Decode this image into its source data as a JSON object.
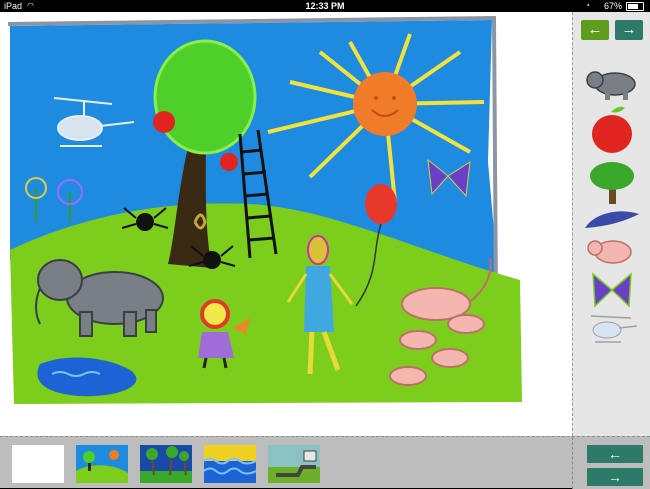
{
  "status_bar": {
    "carrier": "iPad",
    "time": "12:33 PM",
    "battery": "67%"
  },
  "sidebar": {
    "back_arrow": "←",
    "forward_arrow": "→",
    "stamps": [
      "elephant",
      "apple",
      "tree",
      "blue-cloud",
      "pig",
      "butterfly",
      "helicopter"
    ]
  },
  "bottom_bar": {
    "scenes": [
      "blank-scene",
      "park-scene",
      "palm-beach-scene",
      "ocean-waves-scene",
      "road-scene"
    ],
    "nav_back": "←",
    "nav_forward": "→"
  },
  "colors": {
    "sky": "#1f8be0",
    "grass": "#7ccd1c",
    "sun": "#f07c2a",
    "nav_green": "#2e7a68",
    "nav_lime": "#5e9c1e"
  }
}
